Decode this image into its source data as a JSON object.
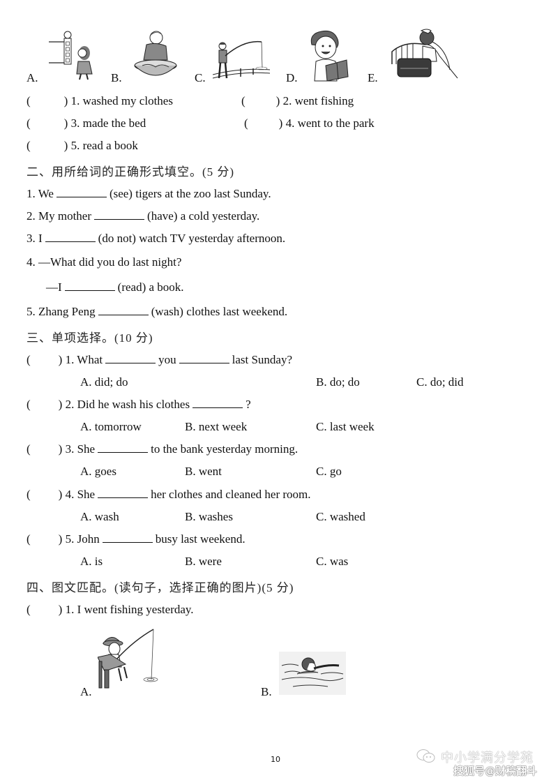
{
  "picture_options": [
    {
      "label": "A.",
      "icon": "girl-walking-to-park-icon"
    },
    {
      "label": "B.",
      "icon": "woman-washing-clothes-icon"
    },
    {
      "label": "C.",
      "icon": "boy-fishing-icon"
    },
    {
      "label": "D.",
      "icon": "boy-reading-book-icon"
    },
    {
      "label": "E.",
      "icon": "girl-making-bed-icon"
    }
  ],
  "section1_items": [
    {
      "paren": "(",
      "paren_close": ")",
      "text": "1. washed my clothes"
    },
    {
      "paren": "(",
      "paren_close": ")",
      "text": "2. went fishing"
    },
    {
      "paren": "(",
      "paren_close": ")",
      "text": "3. made the bed"
    },
    {
      "paren": "(",
      "paren_close": ")",
      "text": "4. went to the park"
    },
    {
      "paren": "(",
      "paren_close": ")",
      "text": "5. read a book"
    }
  ],
  "section2": {
    "title": "二、用所给词的正确形式填空。(5 分)",
    "items": [
      {
        "pre": "1. We",
        "post": "(see) tigers at the zoo last Sunday."
      },
      {
        "pre": "2. My mother",
        "post": "(have) a cold yesterday."
      },
      {
        "pre": "3. I",
        "post": "(do not) watch TV yesterday afternoon."
      },
      {
        "pre": "4.  —What did you do last night?",
        "post": ""
      },
      {
        "pre": "—I",
        "post": "(read) a book."
      },
      {
        "pre": "5. Zhang Peng",
        "post": "(wash) clothes last weekend."
      }
    ]
  },
  "section3": {
    "title": "三、单项选择。(10 分)",
    "questions": [
      {
        "q_pre": "1. What",
        "q_mid": "you",
        "q_post": "last Sunday?",
        "options": [
          "A. did; do",
          "B. do; do",
          "C. do; did"
        ]
      },
      {
        "q_pre": "2. Did he wash his clothes",
        "q_post": "?",
        "options": [
          "A. tomorrow",
          "B. next week",
          "C. last week"
        ]
      },
      {
        "q_pre": "3. She",
        "q_post": "to the bank yesterday morning.",
        "options": [
          "A. goes",
          "B. went",
          "C. go"
        ]
      },
      {
        "q_pre": "4. She",
        "q_post": "her clothes and cleaned her room.",
        "options": [
          "A. wash",
          "B. washes",
          "C. washed"
        ]
      },
      {
        "q_pre": "5. John",
        "q_post": "busy last weekend.",
        "options": [
          "A. is",
          "B. were",
          "C. was"
        ]
      }
    ]
  },
  "section4": {
    "title": "四、图文匹配。(读句子，选择正确的图片)(5 分)",
    "question": "1. I went fishing yesterday.",
    "options": [
      {
        "label": "A.",
        "icon": "boy-fishing-on-pier-icon"
      },
      {
        "label": "B.",
        "icon": "girl-swimming-icon"
      }
    ]
  },
  "footer": {
    "page_number": "10",
    "watermark_line1": "中小学满分学苑",
    "watermark_line2": "搜狐号@财稿翻斗"
  },
  "paren_open": "(",
  "paren_close": ")"
}
